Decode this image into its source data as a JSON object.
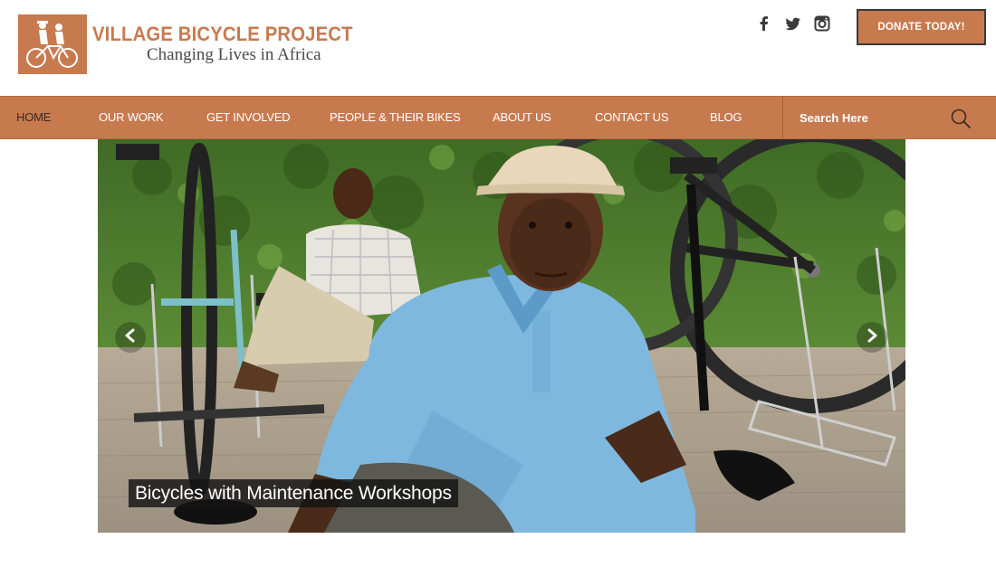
{
  "header": {
    "logo_title": "VILLAGE BICYCLE PROJECT",
    "logo_tagline": "Changing Lives in Africa",
    "social": [
      "facebook-icon",
      "twitter-icon",
      "instagram-icon"
    ],
    "donate_label": "DONATE TODAY!"
  },
  "nav": {
    "items": [
      {
        "label": "HOME"
      },
      {
        "label": "OUR WORK"
      },
      {
        "label": "GET INVOLVED"
      },
      {
        "label": "PEOPLE & THEIR BIKES"
      },
      {
        "label": "ABOUT US"
      },
      {
        "label": "CONTACT US"
      },
      {
        "label": "BLOG"
      }
    ],
    "search_placeholder": "Search Here"
  },
  "slider": {
    "caption": "Bicycles with Maintenance Workshops"
  },
  "colors": {
    "brand": "#c87a4f",
    "nav_text": "#ffffff",
    "active_text": "#3a2a20"
  }
}
